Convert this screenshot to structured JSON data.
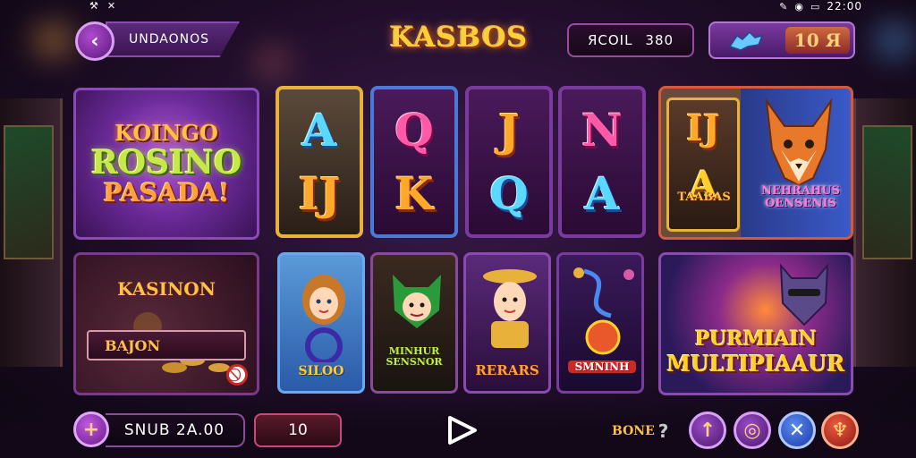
{
  "status_bar": {
    "time": "22:00"
  },
  "header": {
    "back_label": "‹",
    "title": "UNDAONOS",
    "logo": "KASBOS",
    "coins_label": "ЯCOIL",
    "coins_value": "380",
    "bet_value": "10 Я"
  },
  "promo": {
    "line1": "KOINGO",
    "line2": "ROSINO",
    "line3": "PASADA!"
  },
  "reels": [
    {
      "symbols": [
        "A",
        "IJ"
      ]
    },
    {
      "symbols": [
        "Q",
        "K"
      ]
    },
    {
      "symbols": [
        "J",
        "Q"
      ]
    },
    {
      "symbols": [
        "N",
        "A"
      ]
    }
  ],
  "feature_panel": {
    "mini_symbols": [
      "IJ",
      "A"
    ],
    "tag_left": "TAABAS",
    "tag_right": "NEHRAHUS OENSENIS"
  },
  "kasinon": {
    "heading": "KASINON",
    "field_value": "BAJON"
  },
  "cards": [
    {
      "label": "SILOO"
    },
    {
      "label": "MINHUR SENSNOR"
    },
    {
      "label": "RERARS"
    },
    {
      "label": "SMNINH"
    }
  ],
  "multiplier": {
    "line1": "PURMIAIN",
    "line2": "MULTIPIAAUR"
  },
  "footer": {
    "plus_label": "+",
    "balance": "SNUB 2A.00",
    "bet": "10",
    "bonus_label": "BONE",
    "bonus_icon": "?"
  },
  "colors": {
    "accent_purple": "#7a3aa0",
    "gold": "#e8b23a",
    "blue": "#4a7ad8"
  }
}
